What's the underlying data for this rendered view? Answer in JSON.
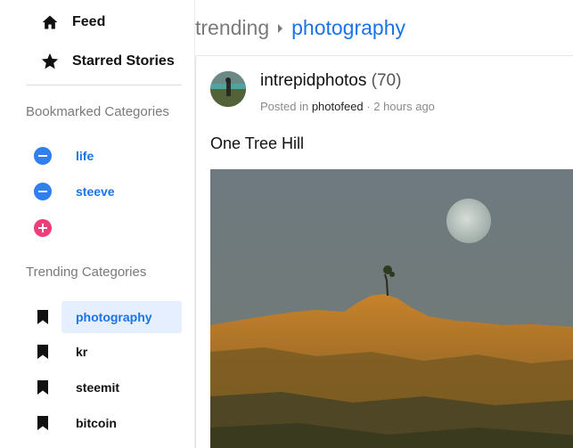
{
  "sidebar": {
    "nav": [
      {
        "label": "Feed",
        "icon": "home-icon"
      },
      {
        "label": "Starred Stories",
        "icon": "star-icon"
      }
    ],
    "bookmarked_title": "Bookmarked Categories",
    "bookmarked": [
      {
        "label": "life",
        "icon": "remove-circle-icon"
      },
      {
        "label": "steeve",
        "icon": "remove-circle-icon"
      }
    ],
    "add_icon": "add-circle-icon",
    "trending_title": "Trending Categories",
    "trending": [
      {
        "label": "photography",
        "icon": "bookmark-icon",
        "active": true
      },
      {
        "label": "kr",
        "icon": "bookmark-icon"
      },
      {
        "label": "steemit",
        "icon": "bookmark-icon"
      },
      {
        "label": "bitcoin",
        "icon": "bookmark-icon"
      }
    ]
  },
  "breadcrumb": {
    "root": "trending",
    "current": "photography"
  },
  "post": {
    "author": "intrepidphotos",
    "reputation": "(70)",
    "posted_in_prefix": "Posted in",
    "category": "photofeed",
    "time": "· 2 hours ago",
    "title": "One Tree Hill"
  },
  "colors": {
    "accent": "#1a73e8",
    "remove_badge": "#2f7ff0",
    "add_badge": "#ee3e7a",
    "active_bg": "#e5efff"
  }
}
